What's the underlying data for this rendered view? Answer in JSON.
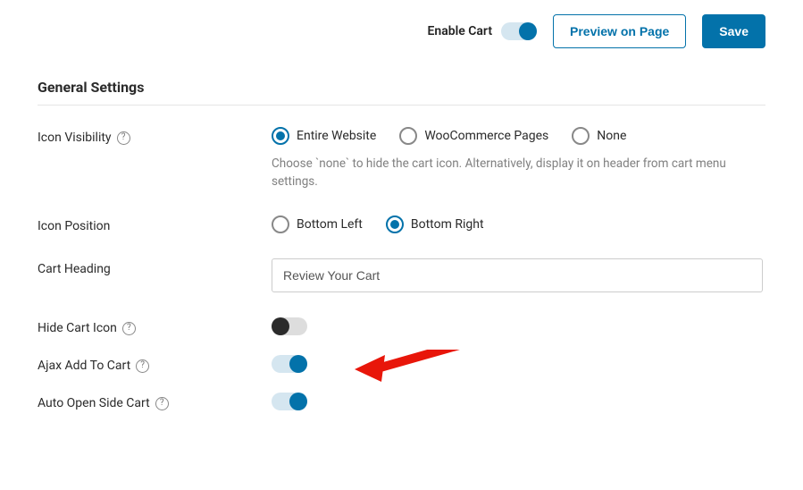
{
  "topbar": {
    "enable_cart_label": "Enable Cart",
    "preview_label": "Preview on Page",
    "save_label": "Save"
  },
  "section_title": "General Settings",
  "icon_visibility": {
    "label": "Icon Visibility",
    "options": {
      "entire": "Entire Website",
      "woo": "WooCommerce Pages",
      "none": "None"
    },
    "desc": "Choose `none` to hide the cart icon. Alternatively, display it on header from cart menu settings."
  },
  "icon_position": {
    "label": "Icon Position",
    "options": {
      "bl": "Bottom Left",
      "br": "Bottom Right"
    }
  },
  "cart_heading": {
    "label": "Cart Heading",
    "value": "Review Your Cart"
  },
  "hide_cart_icon": {
    "label": "Hide Cart Icon"
  },
  "ajax_add": {
    "label": "Ajax Add To Cart"
  },
  "auto_open": {
    "label": "Auto Open Side Cart"
  }
}
